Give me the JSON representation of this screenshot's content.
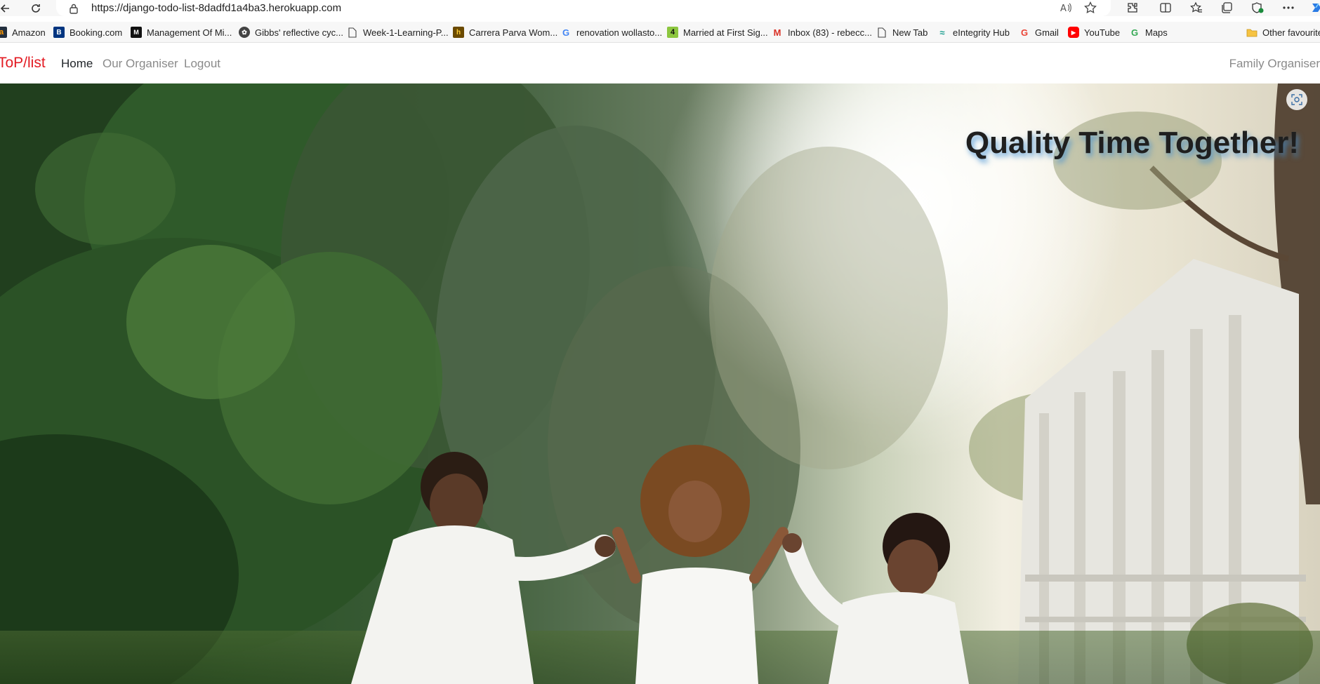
{
  "browser": {
    "url": "https://django-todo-list-8dadfd1a4ba3.herokuapp.com",
    "favourites": [
      {
        "label": "Amazon",
        "icon": "amazon-icon"
      },
      {
        "label": "Booking.com",
        "icon": "booking-icon"
      },
      {
        "label": "Management Of Mi...",
        "icon": "page-favicon-icon"
      },
      {
        "label": "Gibbs' reflective cyc...",
        "icon": "gibbs-icon"
      },
      {
        "label": "Week-1-Learning-P...",
        "icon": "document-icon"
      },
      {
        "label": "Carrera Parva Wom...",
        "icon": "carrera-icon"
      },
      {
        "label": "renovation wollasto...",
        "icon": "google-icon"
      },
      {
        "label": "Married at First Sig...",
        "icon": "channel4-icon"
      },
      {
        "label": "Inbox (83) - rebecc...",
        "icon": "gmail-icon"
      },
      {
        "label": "New Tab",
        "icon": "document-icon"
      },
      {
        "label": "eIntegrity Hub",
        "icon": "eintegrity-icon"
      },
      {
        "label": "Gmail",
        "icon": "google-icon"
      },
      {
        "label": "YouTube",
        "icon": "youtube-icon"
      },
      {
        "label": "Maps",
        "icon": "google-icon"
      }
    ],
    "other_favourites": "Other favourite"
  },
  "site": {
    "brand": "ToP/list",
    "nav": {
      "home": "Home",
      "organiser": "Our Organiser",
      "logout": "Logout",
      "right": "Family Organiser"
    },
    "hero_title": "Quality Time Together!"
  },
  "colors": {
    "brand": "#e31b23",
    "title_shadow": "#3c8cd2"
  }
}
